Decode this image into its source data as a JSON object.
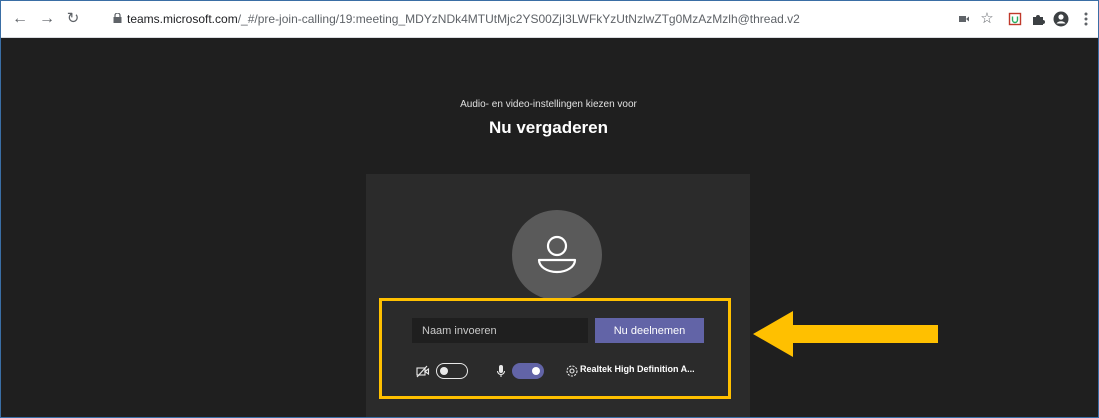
{
  "browser": {
    "url_host": "teams.microsoft.com",
    "url_path": "/_#/pre-join-calling/19:meeting_MDYzNDk4MTUtMjc2YS00ZjI3LWFkYzUtNzlwZTg0MzAzMzlh@thread.v2",
    "icons": [
      "back-icon",
      "forward-icon",
      "reload-icon",
      "lock-icon",
      "camera-icon",
      "star-icon",
      "shield-icon",
      "extensions-icon",
      "profile-icon",
      "menu-icon"
    ]
  },
  "prejoin": {
    "subtitle": "Audio- en video-instellingen kiezen voor",
    "title": "Nu vergaderen",
    "name_placeholder": "Naam invoeren",
    "join_label": "Nu deelnemen",
    "camera_enabled": false,
    "mic_enabled": true,
    "audio_device": "Realtek High Definition A..."
  },
  "colors": {
    "page_bg": "#1f1f1f",
    "card_bg": "#2b2b2b",
    "accent": "#6264a7",
    "annotation": "#ffc000"
  }
}
